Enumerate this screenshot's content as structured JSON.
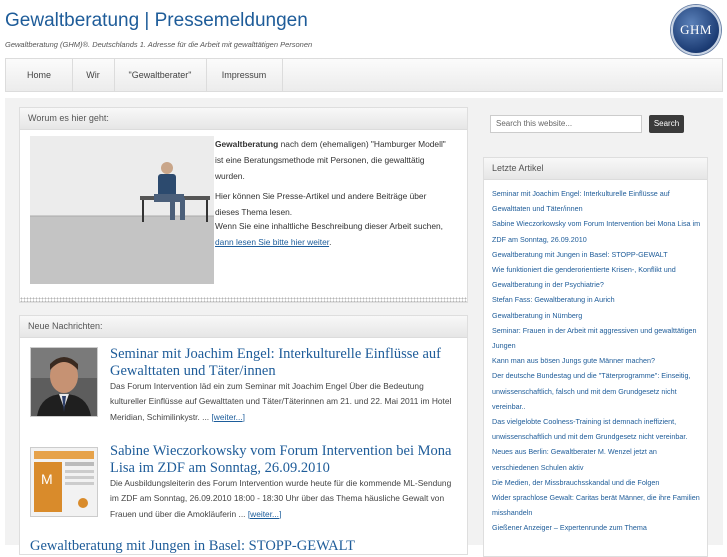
{
  "site": {
    "title": "Gewaltberatung | Pressemeldungen",
    "tagline": "Gewaltberatung (GHM)®. Deutschlands 1. Adresse für die Arbeit mit gewalttätigen Personen",
    "logo_text": "GHM"
  },
  "nav": [
    {
      "label": "Home"
    },
    {
      "label": "Wir"
    },
    {
      "label": "\"Gewaltberater\""
    },
    {
      "label": "Impressum"
    }
  ],
  "intro": {
    "heading": "Worum es hier geht:",
    "bold": "Gewaltberatung",
    "text1": " nach dem (ehemaligen) \"Hamburger Modell\" ist eine Beratungsmethode mit Personen, die gewalttätig wurden.",
    "text2": "Hier können Sie Presse-Artikel und andere Beiträge über dieses Thema lesen.",
    "text3": "Wenn Sie eine inhaltliche Beschreibung dieser Arbeit suchen, ",
    "link": "dann lesen Sie bitte hier weiter",
    "text3_end": "."
  },
  "news": {
    "heading": "Neue Nachrichten:",
    "posts": [
      {
        "title": "Seminar mit Joachim Engel: Interkulturelle Einflüsse auf Gewalttaten und Täter/innen",
        "excerpt": "Das Forum Intervention läd ein zum Seminar mit Joachim Engel Über die Bedeutung kultureller Einflüsse auf Gewalttaten und Täter/Täterinnen am 21. und 22. Mai 2011 im Hotel Meridian, Schimilinkystr. ... ",
        "more": "[weiter...]"
      },
      {
        "title": "Sabine Wieczorkowsky vom Forum Intervention bei Mona Lisa im ZDF am Sonntag, 26.09.2010",
        "excerpt": "Die Ausbildungsleiterin des Forum Intervention wurde heute für die kommende ML-Sendung im ZDF am Sonntag, 26.09.2010 18:00 - 18:30 Uhr über das Thema häusliche Gewalt von Frauen und über die Amokläuferin ... ",
        "more": "[weiter...]"
      }
    ],
    "next_title_partial": "Gewaltberatung mit Jungen in Basel: STOPP-GEWALT"
  },
  "search": {
    "placeholder": "Search this website...",
    "button": "Search"
  },
  "sidebar": {
    "heading": "Letzte Artikel",
    "items": [
      "Seminar mit Joachim Engel: Interkulturelle Einflüsse auf Gewalttaten und Täter/innen",
      "Sabine Wieczorkowsky vom Forum Intervention bei Mona Lisa im ZDF am Sonntag, 26.09.2010",
      "Gewaltberatung mit Jungen in Basel: STOPP-GEWALT",
      "Wie funktioniert die genderorientierte Krisen-, Konflikt und Gewaltberatung in der Psychiatrie?",
      "Stefan Fass: Gewaltberatung in Aurich",
      "Gewaltberatung in Nürnberg",
      "Seminar: Frauen in der Arbeit mit aggressiven und gewalttätigen Jungen",
      "Kann man aus bösen Jungs gute Männer machen?",
      "Der deutsche Bundestag und die \"Täterprogramme\": Einseitig, unwissenschaftlich, falsch und mit dem Grundgesetz nicht vereinbar..",
      "Das vielgelobte Coolness-Training ist demnach ineffizient, unwissenschaftlich und mit dem Grundgesetz nicht vereinbar.",
      "Neues aus Berlin: Gewaltberater M. Wenzel jetzt an verschiedenen Schulen aktiv",
      "Die Medien, der Missbrauchsskandal und die Folgen",
      "Wider sprachlose Gewalt: Caritas berät Männer, die ihre Familien misshandeln",
      "Gießener Anzeiger – Expertenrunde zum Thema"
    ]
  },
  "colors": {
    "link": "#1e5c99",
    "button": "#3b3b3b"
  }
}
